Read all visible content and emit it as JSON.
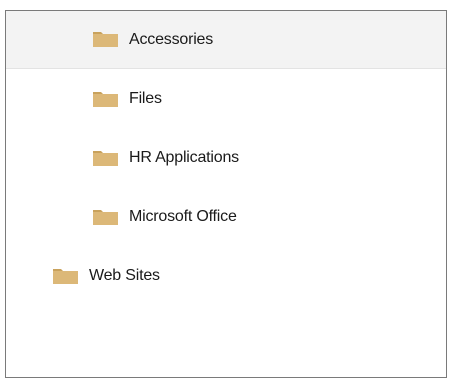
{
  "tree": {
    "items": [
      {
        "label": "Accessories",
        "icon": "folder-icon",
        "level": 1,
        "selected": true
      },
      {
        "label": "Files",
        "icon": "folder-icon",
        "level": 1,
        "selected": false
      },
      {
        "label": "HR Applications",
        "icon": "folder-icon",
        "level": 1,
        "selected": false
      },
      {
        "label": "Microsoft Office",
        "icon": "folder-icon",
        "level": 1,
        "selected": false
      },
      {
        "label": "Web Sites",
        "icon": "folder-icon",
        "level": 0,
        "selected": false
      }
    ]
  },
  "colors": {
    "folder": "#dcb878",
    "folder_tab": "#c9a25c",
    "selection_bg": "#f3f3f3",
    "border": "#7a7a7a"
  }
}
